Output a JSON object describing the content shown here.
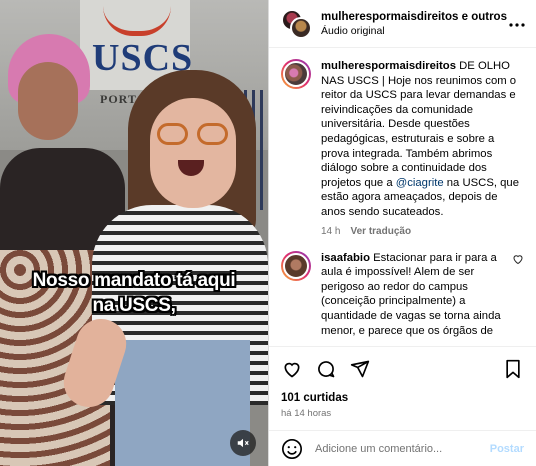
{
  "video": {
    "sign_text": "USCS",
    "sign_subtext": "PORTARIA",
    "caption_line1": "Nosso mandato tá aqui",
    "caption_line2": "na USCS,",
    "mute_icon": "speaker-muted-icon"
  },
  "header": {
    "title_user": "mulherespormaisdireitos",
    "title_rest": " e outros",
    "subtitle": "Áudio original",
    "more_icon": "more-horizontal-icon"
  },
  "post": {
    "username": "mulherespormaisdireitos",
    "caption_before_mention": " DE OLHO NAS USCS | Hoje nos reunimos com o reitor da USCS para levar demandas e reivindicações da comunidade universitária. Desde questões pedagógicas, estruturais e sobre a prova integrada. Também abrimos diálogo sobre a continuidade dos projetos que a ",
    "mention": "@ciagrite",
    "caption_after_mention": " na USCS, que estão agora ameaçados, depois de anos sendo sucateados.",
    "time": "14 h",
    "translate": "Ver tradução"
  },
  "comment": {
    "username": "isaafabio",
    "text": " Estacionar para ir para a aula é impossível! Alem de ser perigoso ao redor do campus (conceição principalmente) a quantidade de vagas se torna ainda menor, e parece que os órgãos de"
  },
  "actions": {
    "likes": "101 curtidas",
    "time_ago": "há 14 horas"
  },
  "add_comment": {
    "placeholder": "Adicione um comentário...",
    "post_label": "Postar"
  },
  "colors": {
    "accent_blue": "#0095f6",
    "disabled_blue": "#b3dbff",
    "muted_text": "#737373",
    "mention": "#00376b"
  }
}
